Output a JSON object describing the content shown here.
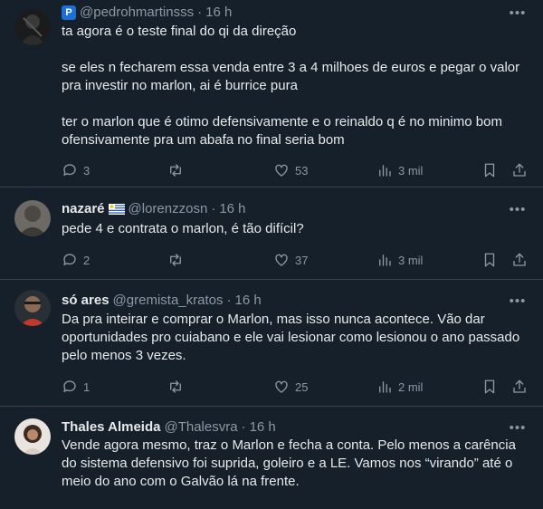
{
  "tweets": [
    {
      "name": "",
      "handle": "@pedrohmartinsss",
      "time": "16 h",
      "paragraphs": [
        "ta agora é o teste final do qi da direção",
        "se eles n fecharem essa venda entre 3 a 4 milhoes de euros e pegar o valor pra investir no marlon, ai é burrice pura",
        "ter o marlon que é otimo defensivamente e o reinaldo q é no minimo bom ofensivamente pra um abafa no final seria bom"
      ],
      "replies": "3",
      "retweets": "",
      "likes": "53",
      "views": "3 mil"
    },
    {
      "name": "nazaré",
      "handle": "@lorenzzosn",
      "time": "16 h",
      "paragraphs": [
        "pede 4 e contrata o marlon, é tão difícil?"
      ],
      "replies": "2",
      "retweets": "",
      "likes": "37",
      "views": "3 mil"
    },
    {
      "name": "só ares",
      "handle": "@gremista_kratos",
      "time": "16 h",
      "paragraphs": [
        "Da pra inteirar e comprar o Marlon, mas isso nunca acontece. Vão dar oportunidades pro cuiabano e ele vai lesionar como lesionou o ano passado pelo menos 3 vezes."
      ],
      "replies": "1",
      "retweets": "",
      "likes": "25",
      "views": "2 mil"
    },
    {
      "name": "Thales Almeida",
      "handle": "@Thalesvra",
      "time": "16 h",
      "paragraphs": [
        "Vende agora mesmo, traz o Marlon e fecha a conta. Pelo menos a carência do sistema defensivo foi suprida, goleiro e a LE. Vamos nos “virando” até o meio do ano com o Galvão lá na frente."
      ]
    }
  ],
  "badges": {
    "tweet0_prefix_icon": "p-pill-icon",
    "tweet1_flag": "uruguay-flag-icon",
    "more_icon": "more-horizontal-icon"
  },
  "colors": {
    "background": "#15202b",
    "text": "#e7e9ea",
    "muted": "#8b98a5",
    "divider": "#38444d"
  }
}
